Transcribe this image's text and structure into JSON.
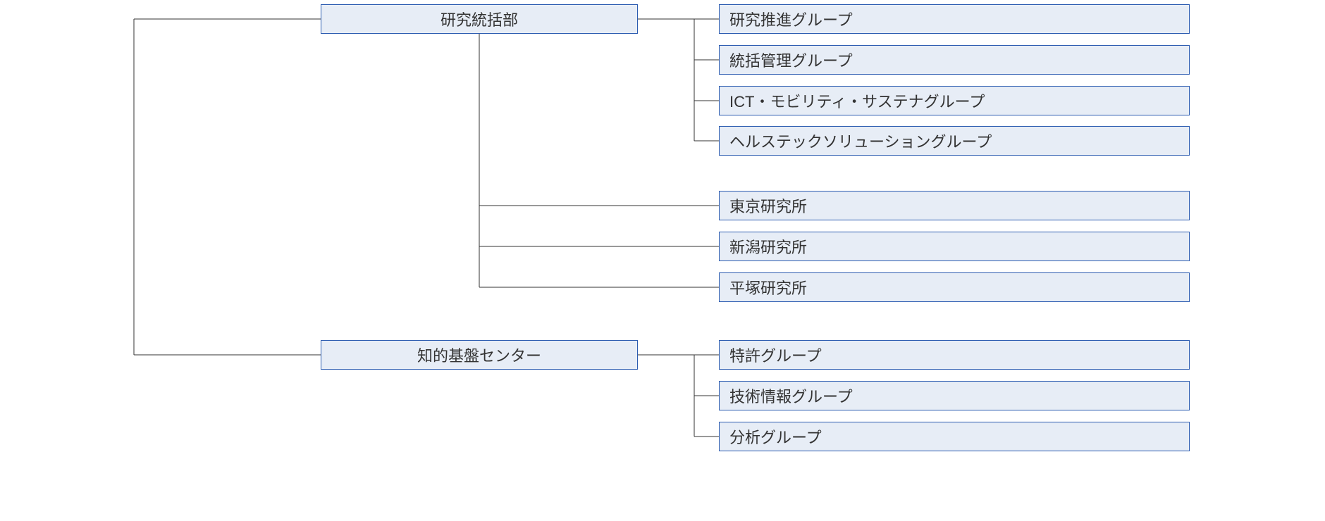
{
  "departments": {
    "research_division": "研究統括部",
    "ip_center": "知的基盤センター"
  },
  "research_groups": [
    "研究推進グループ",
    "統括管理グループ",
    "ICT・モビリティ・サステナグループ",
    "ヘルステックソリューショングループ"
  ],
  "research_labs": [
    "東京研究所",
    "新潟研究所",
    "平塚研究所"
  ],
  "ip_groups": [
    "特許グループ",
    "技術情報グループ",
    "分析グループ"
  ]
}
